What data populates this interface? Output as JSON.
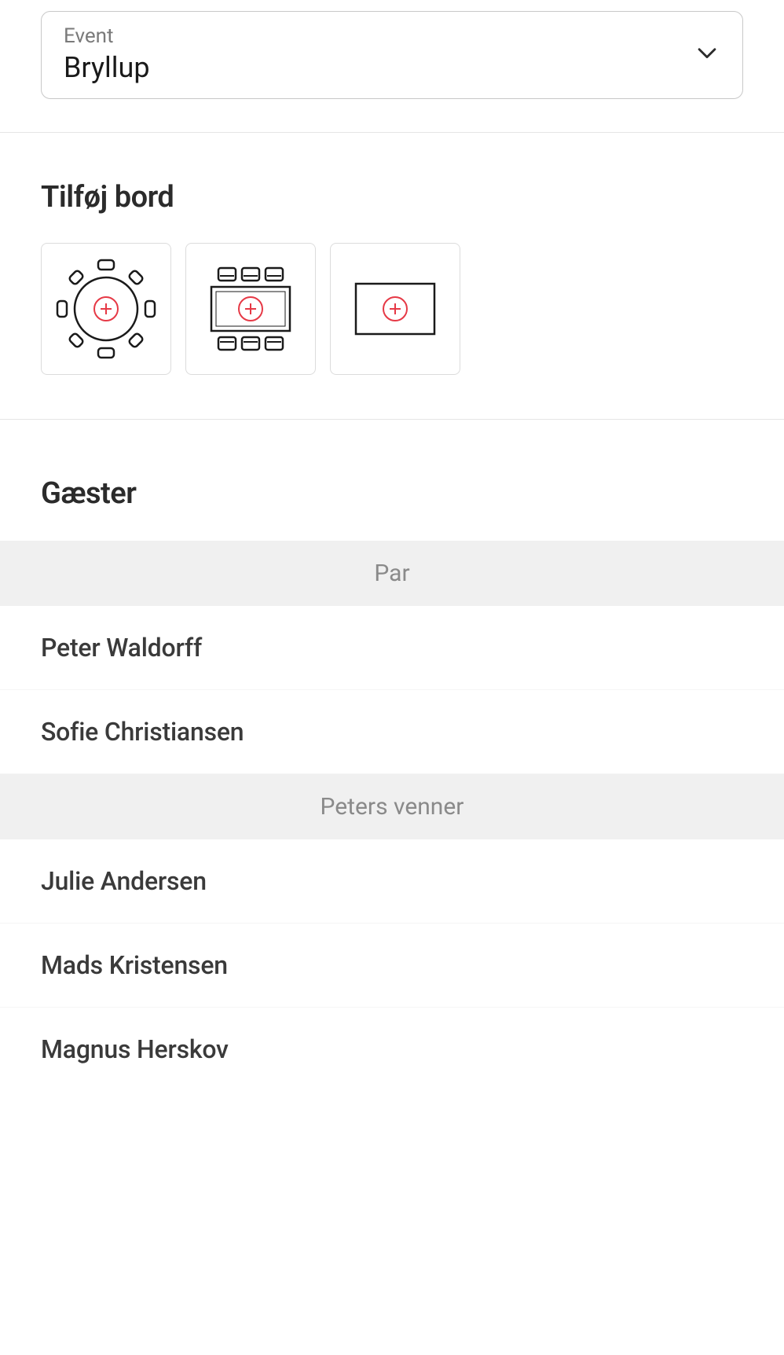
{
  "eventSelector": {
    "label": "Event",
    "value": "Bryllup",
    "icons": {
      "chevron": "chevron-down"
    }
  },
  "addTable": {
    "title": "Tilføj bord",
    "options": [
      {
        "name": "round-table",
        "icon": "round-table-icon"
      },
      {
        "name": "rect-table-chairs",
        "icon": "rect-table-chairs-icon"
      },
      {
        "name": "rect-table-plain",
        "icon": "rect-table-plain-icon"
      }
    ],
    "accentColor": "#e63946"
  },
  "guests": {
    "title": "Gæster",
    "groups": [
      {
        "name": "Par",
        "members": [
          "Peter Waldorff",
          "Sofie Christiansen"
        ]
      },
      {
        "name": "Peters venner",
        "members": [
          "Julie Andersen",
          "Mads Kristensen",
          "Magnus Herskov"
        ]
      }
    ]
  }
}
